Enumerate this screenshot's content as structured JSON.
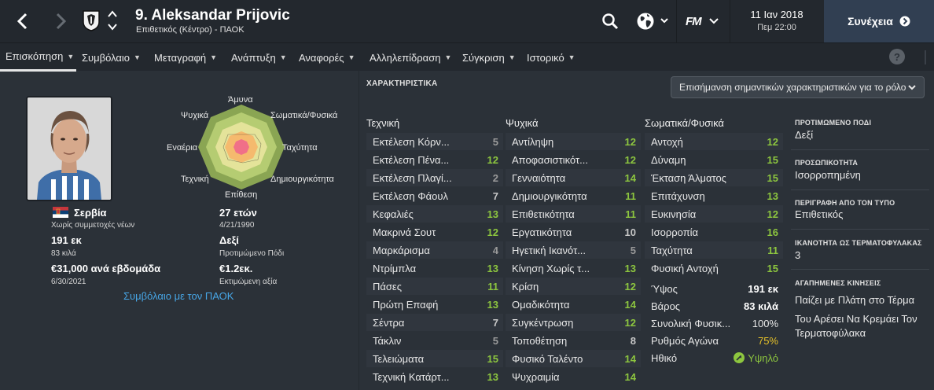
{
  "header": {
    "player_name": "9. Aleksandar Prijovic",
    "player_sub": "Επιθετικός (Κέντρο) - ΠΑΟΚ",
    "date": "11 Ιαν 2018",
    "time": "Πεμ 22:00",
    "continue_label": "Συνέχεια",
    "fm_logo": "FM"
  },
  "tabs": [
    {
      "label": "Επισκόπηση"
    },
    {
      "label": "Συμβόλαιο"
    },
    {
      "label": "Μεταγραφή"
    },
    {
      "label": "Ανάπτυξη"
    },
    {
      "label": "Αναφορές"
    },
    {
      "label": "Αλληλεπίδραση"
    },
    {
      "label": "Σύγκριση"
    },
    {
      "label": "Ιστορικό"
    }
  ],
  "help": "?",
  "profile": {
    "nationality": "Σερβία",
    "youth_caps": "Χωρίς συμμετοχές νέων",
    "height": "191 εκ",
    "weight": "83 κιλά",
    "wage": "€31,000 ανά εβδομάδα",
    "contract_end": "6/30/2021",
    "age": "27 ετών",
    "dob": "4/21/1990",
    "foot": "Δεξί",
    "foot_label": "Προτιμώμενο Πόδι",
    "value": "€1.2εκ.",
    "value_label": "Εκτιμώμενη αξία",
    "contract_link": "Συμβόλαιο με τον ΠΑΟΚ"
  },
  "radar": {
    "labels": {
      "top": "Άμυνα",
      "top_right": "Σωματικά/Φυσικά",
      "right": "Ταχύτητα",
      "bottom_right": "Δημιουργικότητα",
      "bottom": "Επίθεση",
      "bottom_left": "Τεχνική",
      "left": "Εναέρια",
      "top_left": "Ψυχικά"
    }
  },
  "attributes": {
    "section_title": "ΧΑΡΑΚΤΗΡΙΣΤΙΚΑ",
    "highlight_dropdown": "Επισήμανση σημαντικών χαρακτηριστικών για το ρόλο",
    "technical": {
      "title": "Τεχνική",
      "rows": [
        {
          "name": "Εκτέλεση Κόρν...",
          "value": "5"
        },
        {
          "name": "Εκτέλεση Πένα...",
          "value": "12"
        },
        {
          "name": "Εκτέλεση Πλαγί...",
          "value": "2"
        },
        {
          "name": "Εκτέλεση Φάουλ",
          "value": "7"
        },
        {
          "name": "Κεφαλιές",
          "value": "13"
        },
        {
          "name": "Μακρινά Σουτ",
          "value": "12"
        },
        {
          "name": "Μαρκάρισμα",
          "value": "4"
        },
        {
          "name": "Ντρίμπλα",
          "value": "13"
        },
        {
          "name": "Πάσες",
          "value": "11"
        },
        {
          "name": "Πρώτη Επαφή",
          "value": "13"
        },
        {
          "name": "Σέντρα",
          "value": "7"
        },
        {
          "name": "Τάκλιν",
          "value": "5"
        },
        {
          "name": "Τελειώματα",
          "value": "15"
        },
        {
          "name": "Τεχνική Κατάρτ...",
          "value": "13"
        }
      ]
    },
    "mental": {
      "title": "Ψυχικά",
      "rows": [
        {
          "name": "Αντίληψη",
          "value": "12"
        },
        {
          "name": "Αποφασιστικότ...",
          "value": "12"
        },
        {
          "name": "Γενναιότητα",
          "value": "14"
        },
        {
          "name": "Δημιουργικότητα",
          "value": "11"
        },
        {
          "name": "Επιθετικότητα",
          "value": "11"
        },
        {
          "name": "Εργατικότητα",
          "value": "10"
        },
        {
          "name": "Ηγετική Ικανότ...",
          "value": "5"
        },
        {
          "name": "Κίνηση Χωρίς τ...",
          "value": "13"
        },
        {
          "name": "Κρίση",
          "value": "12"
        },
        {
          "name": "Ομαδικότητα",
          "value": "14"
        },
        {
          "name": "Συγκέντρωση",
          "value": "12"
        },
        {
          "name": "Τοποθέτηση",
          "value": "8"
        },
        {
          "name": "Φυσικό Ταλέντο",
          "value": "14"
        },
        {
          "name": "Ψυχραιμία",
          "value": "14"
        }
      ]
    },
    "physical": {
      "title": "Σωματικά/Φυσικά",
      "rows": [
        {
          "name": "Αντοχή",
          "value": "12"
        },
        {
          "name": "Δύναμη",
          "value": "15"
        },
        {
          "name": "Έκταση Άλματος",
          "value": "15"
        },
        {
          "name": "Επιτάχυνση",
          "value": "13"
        },
        {
          "name": "Ευκινησία",
          "value": "12"
        },
        {
          "name": "Ισορροπία",
          "value": "16"
        },
        {
          "name": "Ταχύτητα",
          "value": "11"
        },
        {
          "name": "Φυσική Αντοχή",
          "value": "15"
        }
      ],
      "extra": [
        {
          "name": "Ύψος",
          "value": "191 εκ"
        },
        {
          "name": "Βάρος",
          "value": "83 κιλά"
        },
        {
          "name": "Συνολική Φυσικ...",
          "value": "100%"
        },
        {
          "name": "Ρυθμός Αγώνα",
          "value": "75%"
        },
        {
          "name": "Ηθικό",
          "value": "Υψηλό"
        }
      ]
    }
  },
  "info": {
    "preferred_foot_head": "ΠΡΟΤΙΜΩΜΕΝΟ ΠΟΔΙ",
    "preferred_foot": "Δεξί",
    "personality_head": "ΠΡΟΣΩΠΙΚΟΤΗΤΑ",
    "personality": "Ισορροπημένη",
    "media_head": "ΠΕΡΙΓΡΑΦΗ ΑΠΟ ΤΟΝ ΤΥΠΟ",
    "media": "Επιθετικός",
    "gk_head": "ΙΚΑΝΟΤΗΤΑ ΩΣ ΤΕΡΜΑΤΟΦΥΛΑΚΑΣ",
    "gk": "3",
    "moves_head": "ΑΓΑΠΗΜΕΝΕΣ ΚΙΝΗΣΕΙΣ",
    "move1": "Παίζει με Πλάτη στο Τέρμα",
    "move2_line1": "Του Αρέσει Να Κρεμάει Τον",
    "move2_line2": "Τερματοφύλακα"
  },
  "colors": {
    "green": "#8dc63f",
    "light": "#c8c8c8",
    "gray": "#9a9a9a",
    "yellow": "#e6c229",
    "link": "#47a6e6"
  }
}
